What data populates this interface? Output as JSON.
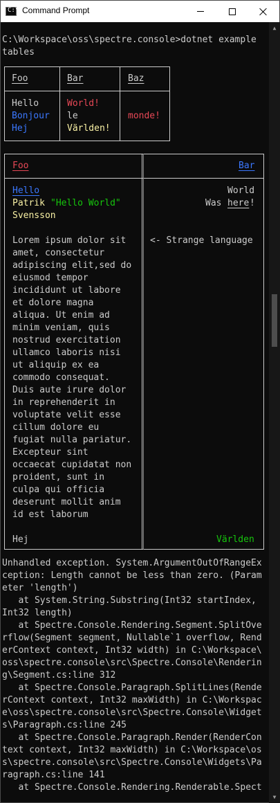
{
  "window": {
    "title": "Command Prompt",
    "icon": "C:\\",
    "controls": [
      "minimize-icon",
      "maximize-icon",
      "close-icon"
    ]
  },
  "console": {
    "command_lines": [
      "C:\\Workspace\\oss\\spectre.console>dotnet example",
      "tables"
    ],
    "table1": {
      "headers": [
        "Foo",
        "Bar",
        "Baz"
      ],
      "rows": [
        [
          "Hello",
          "World!",
          ""
        ],
        [
          "Bonjour",
          "le",
          "monde!"
        ],
        [
          "Hej",
          "Världen!",
          ""
        ]
      ],
      "colors": {
        "col1": [
          "#cccccc",
          "#3b78ff",
          "#3b78ff"
        ],
        "col2": [
          "#e74856",
          "#cccccc",
          "#f9f1a5"
        ],
        "col3": "#e74856"
      }
    },
    "table2": {
      "headers": [
        "Foo",
        "Bar"
      ],
      "left": {
        "hello": "Hello",
        "patrik": "Patrik",
        "hello_world": "\"Hello World\"",
        "svensson": "Svensson",
        "lorem": [
          "Lorem ipsum dolor sit",
          "amet, consectetur",
          "adipiscing elit,sed do",
          "eiusmod tempor",
          "incididunt ut labore",
          "et dolore magna",
          "aliqua. Ut enim ad",
          "minim veniam, quis",
          "nostrud exercitation",
          "ullamco laboris nisi",
          "ut aliquip ex ea",
          "commodo consequat.",
          "Duis aute irure dolor",
          "in reprehenderit in",
          "voluptate velit esse",
          "cillum dolore eu",
          "fugiat nulla pariatur.",
          "Excepteur sint",
          "occaecat cupidatat non",
          "proident, sunt in",
          "culpa qui officia",
          "deserunt mollit anim",
          "id est laborum"
        ],
        "hej": "Hej"
      },
      "right": {
        "world": "World",
        "was": "Was",
        "here": "here",
        "bang": "!",
        "strange": "<- Strange language",
        "varlden": "Världen"
      }
    },
    "exception_lines": [
      "Unhandled exception. System.ArgumentOutOfRangeEx",
      "ception: Length cannot be less than zero. (Param",
      "eter 'length')",
      "   at System.String.Substring(Int32 startIndex,",
      "Int32 length)",
      "   at Spectre.Console.Rendering.Segment.SplitOve",
      "rflow(Segment segment, Nullable`1 overflow, Rend",
      "erContext context, Int32 width) in C:\\Workspace\\",
      "oss\\spectre.console\\src\\Spectre.Console\\Renderin",
      "g\\Segment.cs:line 312",
      "   at Spectre.Console.Paragraph.SplitLines(Rende",
      "rContext context, Int32 maxWidth) in C:\\Workspac",
      "e\\oss\\spectre.console\\src\\Spectre.Console\\Widget",
      "s\\Paragraph.cs:line 245",
      "   at Spectre.Console.Paragraph.Render(RenderCon",
      "text context, Int32 maxWidth) in C:\\Workspace\\os",
      "s\\spectre.console\\src\\Spectre.Console\\Widgets\\Pa",
      "ragraph.cs:line 141",
      "   at Spectre.Console.Rendering.Renderable.Spect"
    ]
  }
}
